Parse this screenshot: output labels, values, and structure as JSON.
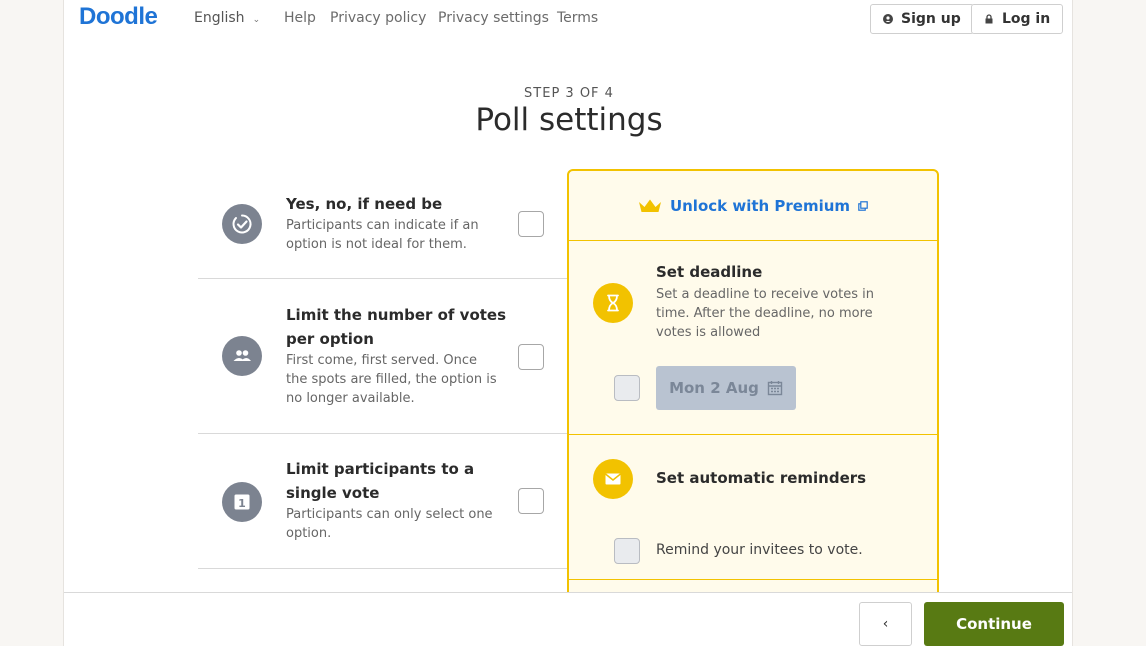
{
  "header": {
    "logo": "Doodle",
    "language": "English",
    "nav": [
      "Help",
      "Privacy policy",
      "Privacy settings",
      "Terms"
    ],
    "signup_label": "Sign up",
    "login_label": "Log in"
  },
  "step": {
    "indicator": "STEP 3 OF 4",
    "title": "Poll settings"
  },
  "options": [
    {
      "title": "Yes, no, if need be",
      "description": "Participants can indicate if an option is not ideal for them.",
      "checked": false,
      "icon": "check-circle-icon"
    },
    {
      "title": "Limit the number of votes per option",
      "description": "First come, first served. Once the spots are filled, the option is no longer available.",
      "checked": false,
      "icon": "people-icon"
    },
    {
      "title": "Limit participants to a single vote",
      "description": "Participants can only select one option.",
      "checked": false,
      "icon": "number-one-icon"
    }
  ],
  "premium": {
    "unlock_label": "Unlock with Premium",
    "deadline": {
      "title": "Set deadline",
      "description": "Set a deadline to receive votes in time. After the deadline, no more votes is allowed",
      "date": "Mon 2 Aug",
      "checked": false
    },
    "reminders": {
      "title": "Set automatic reminders",
      "remind_label": "Remind your invitees to vote.",
      "checked": false
    }
  },
  "footer": {
    "back_label": "‹",
    "continue_label": "Continue"
  },
  "colors": {
    "brand_blue": "#1f74d6",
    "premium_yellow": "#f2c200",
    "premium_bg": "#fffbeb",
    "continue_green": "#587a13",
    "icon_gray": "#7c8390"
  }
}
